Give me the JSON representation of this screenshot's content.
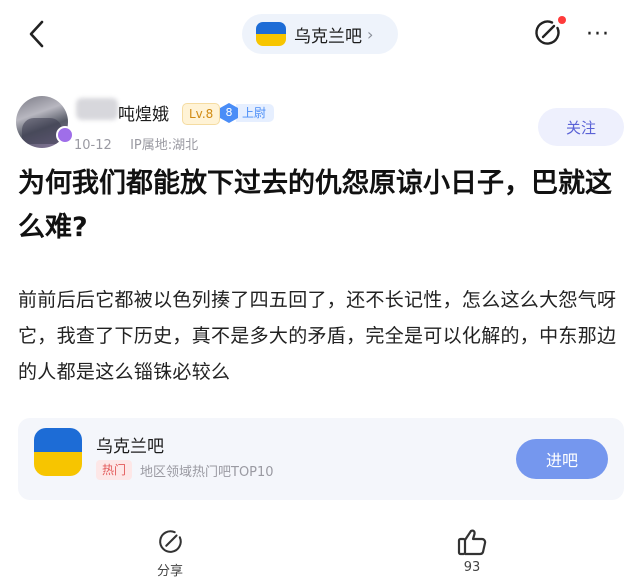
{
  "topbar": {
    "forum_name": "乌克兰吧",
    "chevron": "›",
    "more": "···"
  },
  "author": {
    "name": "吨煌娥",
    "level": "Lv.8",
    "up_number": "8",
    "up_label": "上尉",
    "date": "10-12",
    "ip_location": "IP属地:湖北",
    "follow_label": "关注"
  },
  "post": {
    "title": "为何我们都能放下过去的仇怨原谅小日子，巴就这么难?",
    "body": "前前后后它都被以色列揍了四五回了，还不长记性，怎么这么大怨气呀它，我查了下历史，真不是多大的矛盾，完全是可以化解的，中东那边的人都是这么锱铢必较么"
  },
  "forum_card": {
    "name": "乌克兰吧",
    "hot_tag": "热门",
    "description": "地区领域热门吧TOP10",
    "enter_label": "进吧"
  },
  "actions": {
    "share_label": "分享",
    "like_count": "93"
  },
  "colors": {
    "flag_blue": "#1d6cd6",
    "flag_yellow": "#f7c500",
    "accent_blue": "#7597ee",
    "follow_text": "#5a62d6",
    "notification_dot": "#ff3b3b"
  },
  "icons": [
    "back-icon",
    "share-edit-icon",
    "more-icon",
    "thumbs-up-icon",
    "flag-icon"
  ]
}
